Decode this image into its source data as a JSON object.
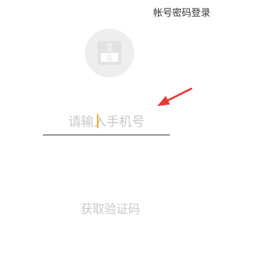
{
  "header": {
    "password_login_link": "帐号密码登录"
  },
  "logo": {
    "icon": "app-logo-icon",
    "text_top": "艾",
    "text_bottom": "面"
  },
  "phone": {
    "placeholder": "请输入手机号",
    "value": ""
  },
  "get_code_button": "获取验证码",
  "annotation": {
    "arrow_icon": "red-arrow-icon",
    "arrow_color": "#e53935"
  },
  "colors": {
    "caret": "#f2b33d",
    "placeholder": "#c7c7c7",
    "button_text": "#c9c9c9",
    "logo_bg": "#eeeeee"
  }
}
